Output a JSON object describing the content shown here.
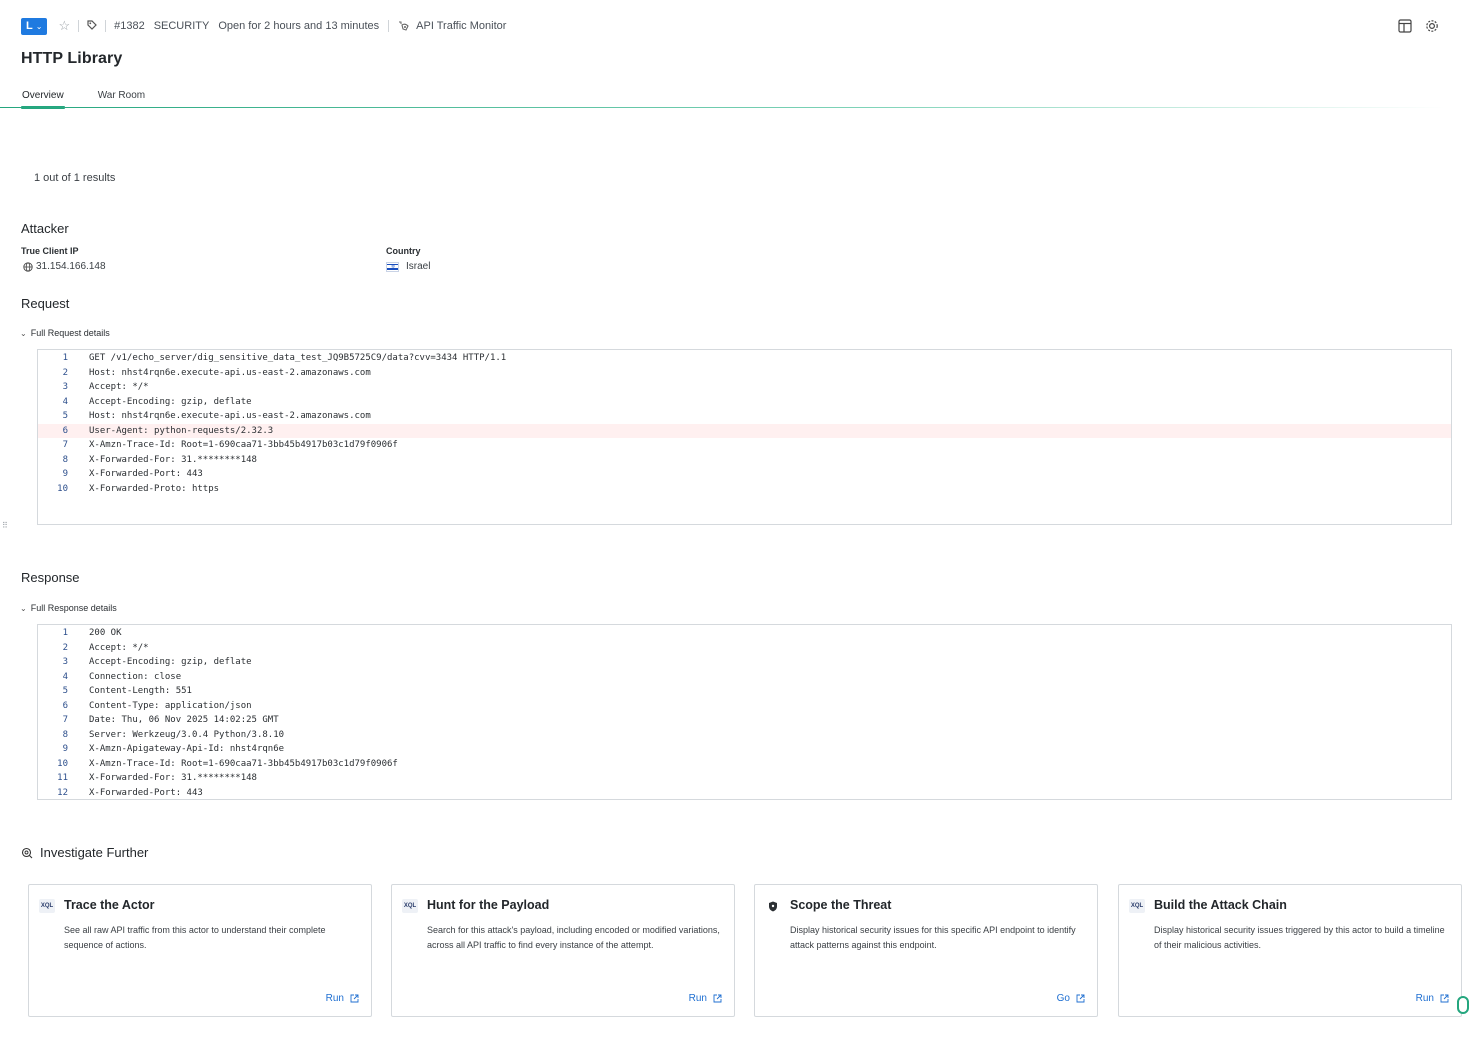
{
  "topbar": {
    "owner_initial": "L",
    "case_id": "#1382",
    "category": "SECURITY",
    "open_duration": "Open for 2 hours and 13 minutes",
    "source": "API Traffic Monitor"
  },
  "page": {
    "title": "HTTP Library"
  },
  "tabs": [
    {
      "label": "Overview"
    },
    {
      "label": "War Room"
    }
  ],
  "results": {
    "summary": "1 out of 1 results"
  },
  "attacker": {
    "title": "Attacker",
    "ip_label": "True Client IP",
    "ip_value": "31.154.166.148",
    "country_label": "Country",
    "country_value": "Israel"
  },
  "request": {
    "title": "Request",
    "toggle_label": "Full Request details",
    "lines": [
      {
        "n": "1",
        "text": "GET /v1/echo_server/dig_sensitive_data_test_JQ9B5725C9/data?cvv=3434 HTTP/1.1"
      },
      {
        "n": "2",
        "text": "Host: nhst4rqn6e.execute-api.us-east-2.amazonaws.com"
      },
      {
        "n": "3",
        "text": "Accept: */*"
      },
      {
        "n": "4",
        "text": "Accept-Encoding: gzip, deflate"
      },
      {
        "n": "5",
        "text": "Host: nhst4rqn6e.execute-api.us-east-2.amazonaws.com"
      },
      {
        "n": "6",
        "text": "User-Agent: python-requests/2.32.3"
      },
      {
        "n": "7",
        "text": "X-Amzn-Trace-Id: Root=1-690caa71-3bb45b4917b03c1d79f0906f"
      },
      {
        "n": "8",
        "text": "X-Forwarded-For: 31.********148"
      },
      {
        "n": "9",
        "text": "X-Forwarded-Port: 443"
      },
      {
        "n": "10",
        "text": "X-Forwarded-Proto: https"
      }
    ]
  },
  "response": {
    "title": "Response",
    "toggle_label": "Full Response details",
    "lines": [
      {
        "n": "1",
        "text": "200 OK"
      },
      {
        "n": "2",
        "text": "Accept: */*"
      },
      {
        "n": "3",
        "text": "Accept-Encoding: gzip, deflate"
      },
      {
        "n": "4",
        "text": "Connection: close"
      },
      {
        "n": "5",
        "text": "Content-Length: 551"
      },
      {
        "n": "6",
        "text": "Content-Type: application/json"
      },
      {
        "n": "7",
        "text": "Date: Thu, 06 Nov 2025 14:02:25 GMT"
      },
      {
        "n": "8",
        "text": "Server: Werkzeug/3.0.4 Python/3.8.10"
      },
      {
        "n": "9",
        "text": "X-Amzn-Apigateway-Api-Id: nhst4rqn6e"
      },
      {
        "n": "10",
        "text": "X-Amzn-Trace-Id: Root=1-690caa71-3bb45b4917b03c1d79f0906f"
      },
      {
        "n": "11",
        "text": "X-Forwarded-For: 31.********148"
      },
      {
        "n": "12",
        "text": "X-Forwarded-Port: 443"
      }
    ]
  },
  "investigate": {
    "title": "Investigate Further",
    "cards": [
      {
        "badge": "XQL",
        "title": "Trace the Actor",
        "desc": "See all raw API traffic from this actor to understand their complete sequence of actions.",
        "action": "Run"
      },
      {
        "badge": "XQL",
        "title": "Hunt for the Payload",
        "desc": "Search for this attack's payload, including encoded or modified variations, across all API traffic to find every instance of the attempt.",
        "action": "Run"
      },
      {
        "badge": "",
        "title": "Scope the Threat",
        "desc": "Display historical security issues for this specific API endpoint to identify attack patterns against this endpoint.",
        "action": "Go"
      },
      {
        "badge": "XQL",
        "title": "Build the Attack Chain",
        "desc": "Display historical security issues triggered by this actor to build a timeline of their malicious activities.",
        "action": "Run"
      }
    ]
  },
  "colors": {
    "accent": "#24a67e",
    "owner_button": "#1f7ae0",
    "link": "#1f6fd1",
    "highlight_row": "#fff0f0"
  }
}
